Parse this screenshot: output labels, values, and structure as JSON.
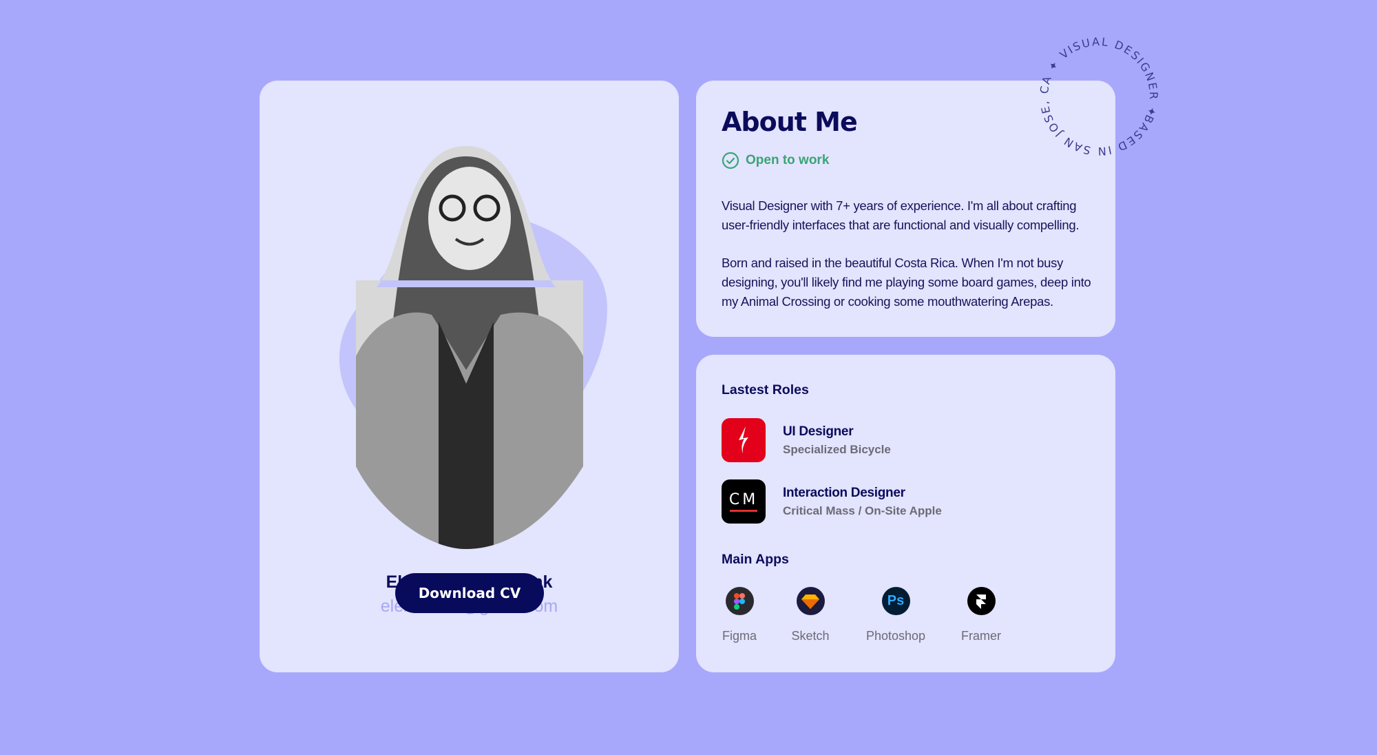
{
  "profile": {
    "name": "Elena Baharet Frank",
    "email": "elebaharet@gmail.com",
    "download_label": "Download CV"
  },
  "about": {
    "title": "About Me",
    "status": "Open to work",
    "status_color": "#3aa476",
    "paragraphs": [
      "Visual Designer with 7+ years of experience. I'm all about crafting user-friendly interfaces that are functional and visually compelling.",
      "Born and raised in the beautiful Costa Rica. When I'm not busy designing, you'll likely find me playing some board games, deep into my Animal Crossing or cooking some mouthwatering Arepas."
    ]
  },
  "badge": {
    "text": "BASED IN SAN JOSE, CA ✦ VISUAL DESIGNER ✦"
  },
  "roles": {
    "title": "Lastest Roles",
    "items": [
      {
        "title": "UI Designer",
        "company": "Specialized Bicycle",
        "icon": "specialized-logo",
        "color": "#e2001a"
      },
      {
        "title": "Interaction Designer",
        "company": "Critical Mass / On-Site Apple",
        "icon": "critical-mass-logo",
        "logo_text": "CM",
        "color": "#000000"
      }
    ]
  },
  "apps": {
    "title": "Main Apps",
    "items": [
      {
        "label": "Figma",
        "icon": "figma-icon"
      },
      {
        "label": "Sketch",
        "icon": "sketch-icon"
      },
      {
        "label": "Photoshop",
        "icon": "photoshop-icon",
        "logo_text": "Ps"
      },
      {
        "label": "Framer",
        "icon": "framer-icon"
      }
    ]
  },
  "colors": {
    "background": "#a7a8fc",
    "card": "#e3e4fd",
    "primary": "#080a5c",
    "accent": "#a7a8f5"
  }
}
